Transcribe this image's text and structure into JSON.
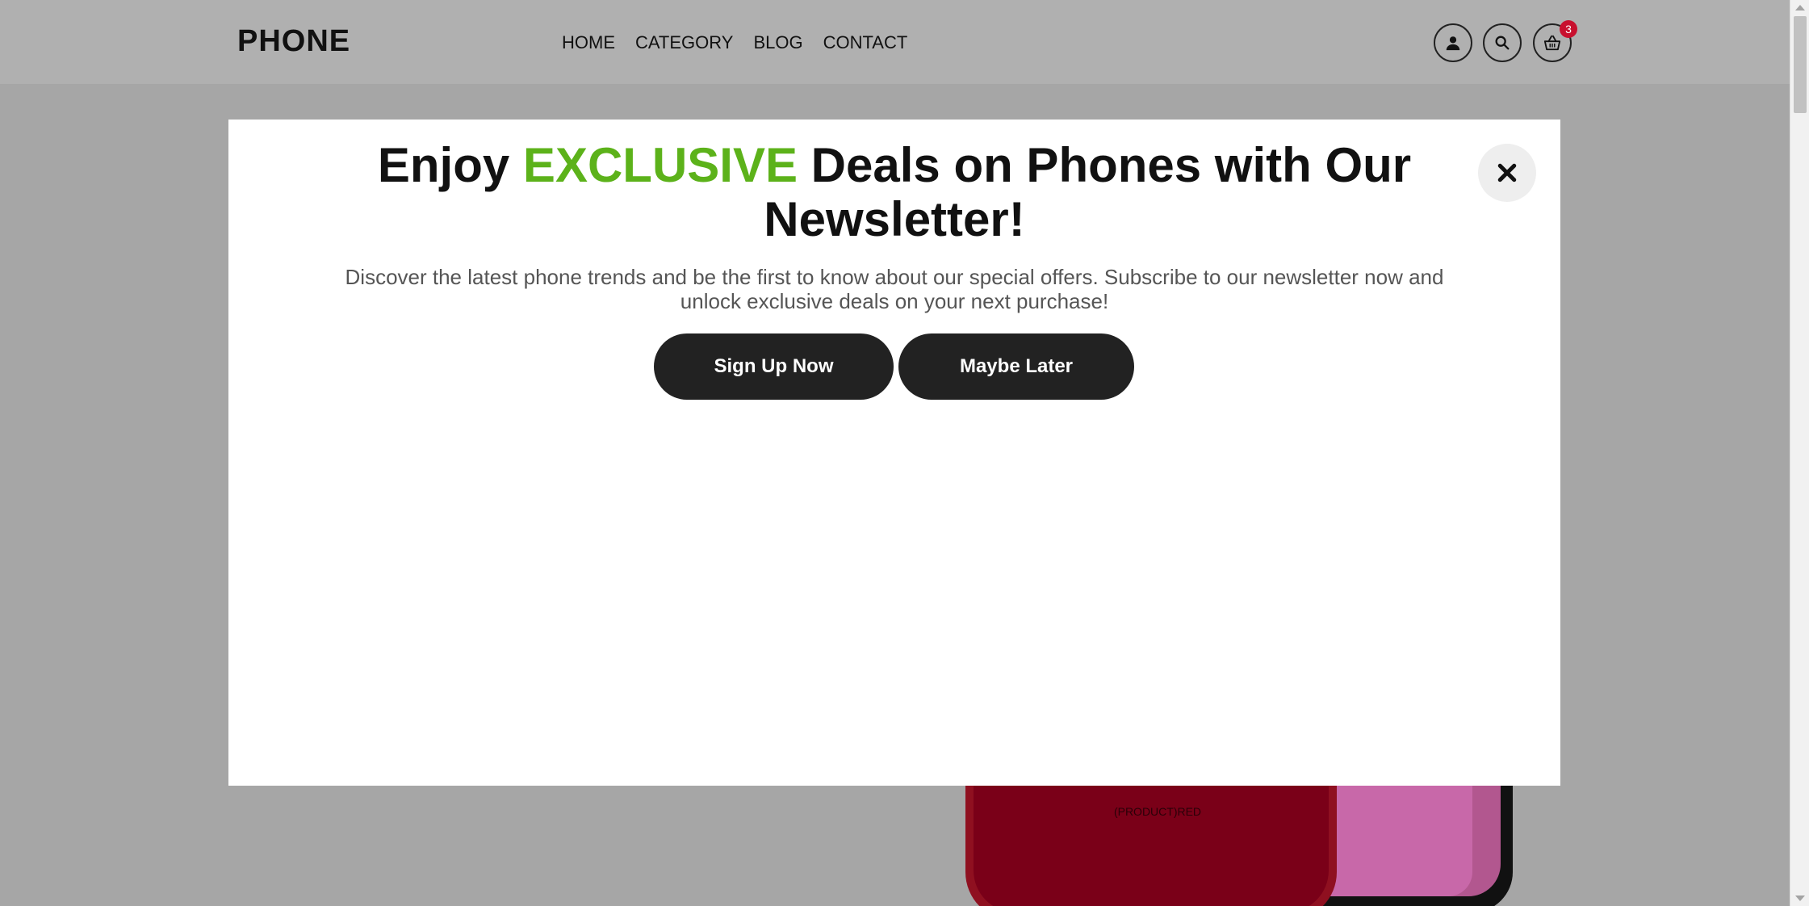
{
  "header": {
    "logo": "PHONE",
    "nav": [
      "HOME",
      "CATEGORY",
      "BLOG",
      "CONTACT"
    ],
    "cart_count": "3"
  },
  "background": {
    "phone_label": "(PRODUCT)RED"
  },
  "modal": {
    "title_pre": "Enjoy",
    "title_highlight": "EXCLUSIVE",
    "title_post": "Deals on Phones with Our Newsletter!",
    "description": "Discover the latest phone trends and be the first to know about our special offers. Subscribe to our newsletter now and unlock exclusive deals on your next purchase!",
    "signup_label": "Sign Up Now",
    "later_label": "Maybe Later"
  },
  "colors": {
    "accent": "#5cb21a",
    "button_bg": "#222222",
    "badge": "#c8102e",
    "overlay": "#a6a6a6"
  },
  "icons": {
    "account": "user-icon",
    "search": "search-icon",
    "cart": "basket-icon",
    "close": "close-icon"
  }
}
